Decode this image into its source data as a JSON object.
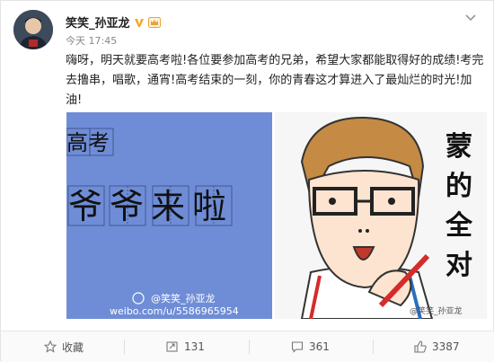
{
  "post": {
    "author": "笑笑_孙亚龙",
    "time": "今天 17:45",
    "text": "嗨呀，明天就要高考啦!各位要参加高考的兄弟，希望大家都能取得好的成绩!考完去撸串，唱歌，通宵!高考结束的一刻，你的青春这才算进入了最灿烂的时光!加油!"
  },
  "images": {
    "left": {
      "top_text": "高考",
      "main_text": "爷爷来啦",
      "watermark_name": "@笑笑_孙亚龙",
      "watermark_url": "weibo.com/u/5586965954"
    },
    "right": {
      "side_text": "蒙的全对",
      "watermark": "@笑笑_孙亚龙"
    }
  },
  "actions": {
    "favorite_label": "收藏",
    "repost_count": "131",
    "comment_count": "361",
    "like_count": "3387"
  },
  "colors": {
    "left_image_bg": "#6f8dd6",
    "verified_badge": "#f6a623"
  }
}
